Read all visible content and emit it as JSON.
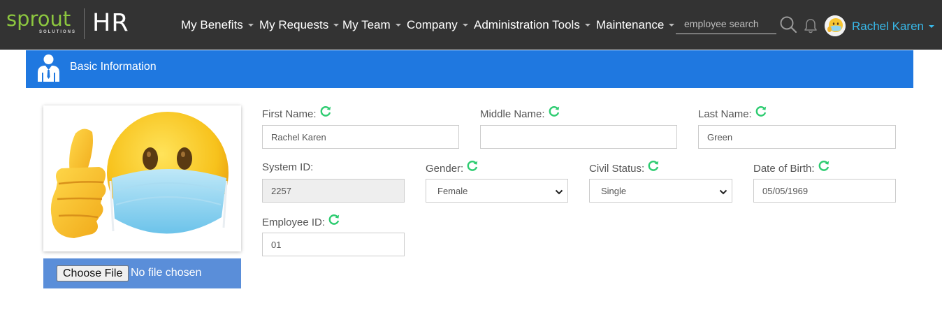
{
  "brand": {
    "logo_text": "sprout",
    "logo_subtext": "SOLUTIONS",
    "product": "HR",
    "accent": "#8cc63f"
  },
  "nav": {
    "items": [
      {
        "label": "My Benefits"
      },
      {
        "label": "My Requests"
      },
      {
        "label": "My Team"
      },
      {
        "label": "Company"
      },
      {
        "label": "Administration Tools"
      },
      {
        "label": "Maintenance"
      }
    ],
    "search_placeholder": "employee search",
    "search_icon": "search-icon",
    "notification_icon": "bell-icon",
    "user_name": "Rachel Karen",
    "user_color": "#38b8e8"
  },
  "section": {
    "title": "Basic Information",
    "icon": "employee-icon",
    "color": "#1f78e0"
  },
  "photo": {
    "alt": "thumbs-up masked emoji"
  },
  "upload": {
    "button_label": "Choose File",
    "status": "No file chosen"
  },
  "form": {
    "first_name": {
      "label": "First Name:",
      "value": "Rachel Karen"
    },
    "middle_name": {
      "label": "Middle Name:",
      "value": ""
    },
    "last_name": {
      "label": "Last Name:",
      "value": "Green"
    },
    "system_id": {
      "label": "System ID:",
      "value": "2257"
    },
    "gender": {
      "label": "Gender:",
      "value": "Female"
    },
    "civil_status": {
      "label": "Civil Status:",
      "value": "Single"
    },
    "date_of_birth": {
      "label": "Date of Birth:",
      "value": "05/05/1969"
    },
    "employee_id": {
      "label": "Employee ID:",
      "value": "01"
    }
  },
  "colors": {
    "navbar": "#333333",
    "sync_icon": "#2ecc71",
    "upload_bar": "#5a8ed9"
  }
}
